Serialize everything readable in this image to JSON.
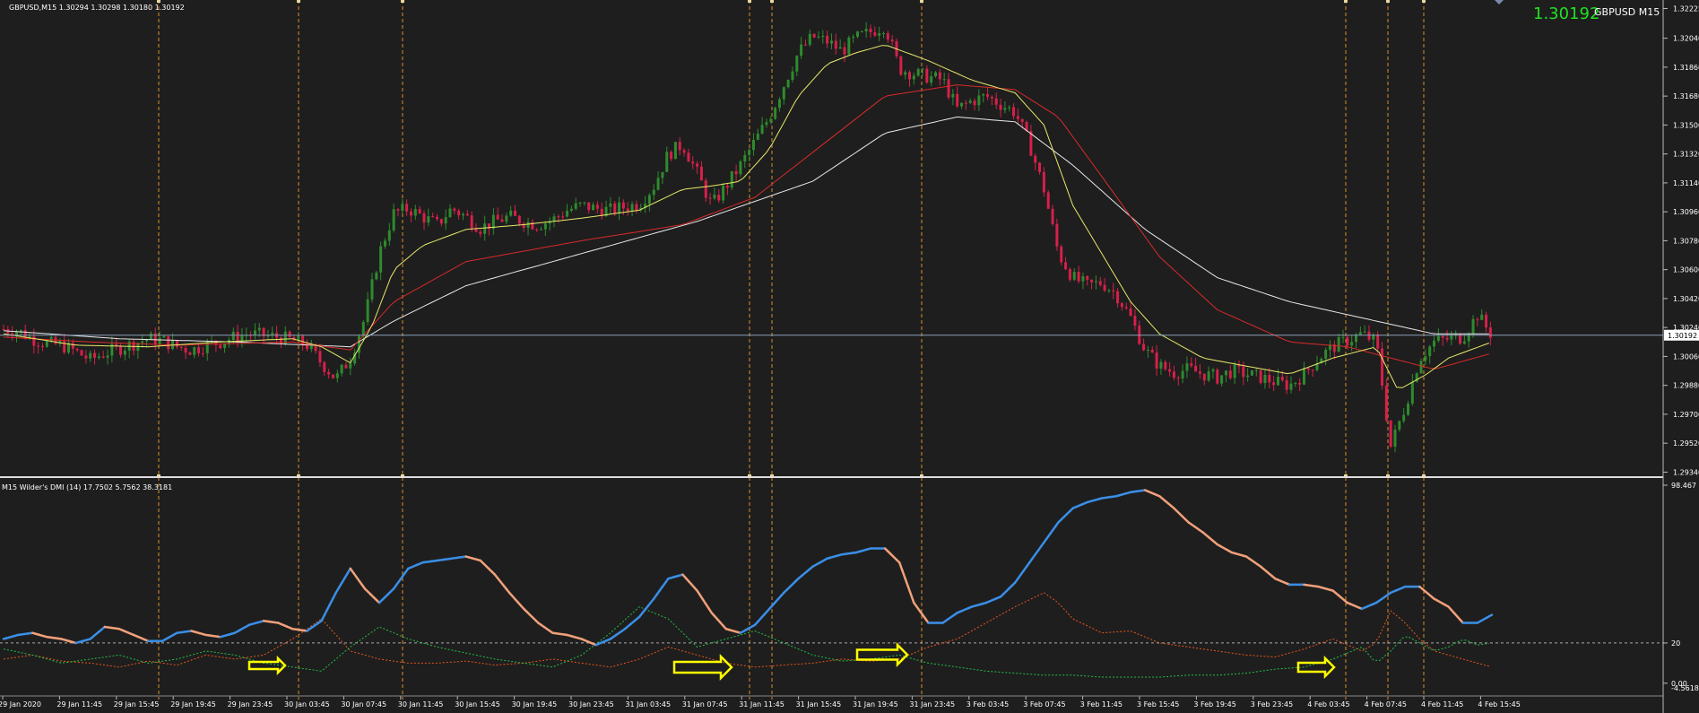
{
  "header": {
    "symbol_info": "GBPUSD,M15  1.30294 1.30298 1.30180 1.30192",
    "current_price": "1.30192",
    "symbol_tf": "GBPUSD M15"
  },
  "indicator": {
    "title": "M15 Wilder's DMI (14) 17.7502 5.7562 38.3181"
  },
  "colors": {
    "background": "#1e1e1e",
    "bull_candle": "#2e8b2e",
    "bear_candle": "#d6204a",
    "ma_fast": "#e8e86a",
    "ma_mid": "#d82a2a",
    "ma_slow": "#e8e8e8",
    "adx_up": "#3a8ee6",
    "adx_down": "#f0a07a",
    "plus_di": "#22c04a",
    "minus_di": "#e8561c",
    "session_line": "#d8902a",
    "current_price_line": "#8aa0b8",
    "big_price": "#22e022",
    "arrow": "#ffff00"
  },
  "price_axis": {
    "ticks": [
      "1.32225",
      "1.32040",
      "1.31860",
      "1.31680",
      "1.31500",
      "1.31320",
      "1.31140",
      "1.30960",
      "1.30780",
      "1.30600",
      "1.30420",
      "1.30240",
      "1.30060",
      "1.29880",
      "1.29700",
      "1.29520",
      "1.29340"
    ],
    "current_label": "1.30192"
  },
  "indicator_axis": {
    "ticks": [
      "98.467",
      "20",
      "0.00"
    ],
    "bottom_label": "-4.5618"
  },
  "time_axis": {
    "labels": [
      "29 Jan 2020",
      "29 Jan 11:45",
      "29 Jan 15:45",
      "29 Jan 19:45",
      "29 Jan 23:45",
      "30 Jan 03:45",
      "30 Jan 07:45",
      "30 Jan 11:45",
      "30 Jan 15:45",
      "30 Jan 19:45",
      "30 Jan 23:45",
      "31 Jan 03:45",
      "31 Jan 07:45",
      "31 Jan 11:45",
      "31 Jan 15:45",
      "31 Jan 19:45",
      "31 Jan 23:45",
      "3 Feb 03:45",
      "3 Feb 07:45",
      "3 Feb 11:45",
      "3 Feb 15:45",
      "3 Feb 19:45",
      "3 Feb 23:45",
      "4 Feb 03:45",
      "4 Feb 07:45",
      "4 Feb 11:45",
      "4 Feb 15:45"
    ]
  },
  "chart_data": {
    "type": "candlestick",
    "symbol": "GBPUSD",
    "timeframe": "M15",
    "price_range": [
      1.2932,
      1.3225
    ],
    "close_path": [
      [
        0,
        1.3023
      ],
      [
        10,
        1.3022
      ],
      [
        20,
        1.3017
      ],
      [
        30,
        1.3014
      ],
      [
        40,
        1.3013
      ],
      [
        50,
        1.3009
      ],
      [
        60,
        1.3004
      ],
      [
        70,
        1.3008
      ],
      [
        80,
        1.3011
      ],
      [
        90,
        1.3014
      ],
      [
        100,
        1.3017
      ],
      [
        110,
        1.3016
      ],
      [
        120,
        1.3012
      ],
      [
        130,
        1.301
      ],
      [
        140,
        1.3013
      ],
      [
        150,
        1.3015
      ],
      [
        160,
        1.3018
      ],
      [
        170,
        1.302
      ],
      [
        180,
        1.3019
      ],
      [
        190,
        1.3018
      ],
      [
        200,
        1.3016
      ],
      [
        210,
        1.3013
      ],
      [
        220,
        1.3002
      ],
      [
        230,
        1.2992
      ],
      [
        240,
        1.3005
      ],
      [
        250,
        1.303
      ],
      [
        260,
        1.307
      ],
      [
        270,
        1.3095
      ],
      [
        280,
        1.3098
      ],
      [
        290,
        1.3093
      ],
      [
        300,
        1.3088
      ],
      [
        310,
        1.3098
      ],
      [
        320,
        1.3093
      ],
      [
        330,
        1.3086
      ],
      [
        340,
        1.309
      ],
      [
        350,
        1.3093
      ],
      [
        360,
        1.309
      ],
      [
        370,
        1.3088
      ],
      [
        380,
        1.3091
      ],
      [
        390,
        1.3097
      ],
      [
        400,
        1.31
      ],
      [
        410,
        1.3098
      ],
      [
        420,
        1.3097
      ],
      [
        430,
        1.3099
      ],
      [
        440,
        1.3101
      ],
      [
        450,
        1.3112
      ],
      [
        460,
        1.3132
      ],
      [
        470,
        1.3138
      ],
      [
        480,
        1.312
      ],
      [
        490,
        1.31
      ],
      [
        500,
        1.3112
      ],
      [
        510,
        1.3125
      ],
      [
        520,
        1.314
      ],
      [
        530,
        1.3155
      ],
      [
        540,
        1.3175
      ],
      [
        550,
        1.3195
      ],
      [
        560,
        1.3205
      ],
      [
        570,
        1.3202
      ],
      [
        580,
        1.3196
      ],
      [
        590,
        1.3204
      ],
      [
        600,
        1.3208
      ],
      [
        610,
        1.3212
      ],
      [
        620,
        1.3185
      ],
      [
        630,
        1.3182
      ],
      [
        640,
        1.318
      ],
      [
        650,
        1.3178
      ],
      [
        660,
        1.316
      ],
      [
        670,
        1.3165
      ],
      [
        680,
        1.3168
      ],
      [
        690,
        1.3163
      ],
      [
        700,
        1.3158
      ],
      [
        710,
        1.3138
      ],
      [
        720,
        1.311
      ],
      [
        730,
        1.307
      ],
      [
        740,
        1.3055
      ],
      [
        750,
        1.305
      ],
      [
        760,
        1.3052
      ],
      [
        770,
        1.3045
      ],
      [
        780,
        1.303
      ],
      [
        790,
        1.301
      ],
      [
        800,
        1.3
      ],
      [
        810,
        1.2996
      ],
      [
        820,
        1.2998
      ],
      [
        830,
        1.2995
      ],
      [
        840,
        1.2993
      ],
      [
        850,
        1.2997
      ],
      [
        860,
        1.2995
      ],
      [
        870,
        1.2993
      ],
      [
        880,
        1.299
      ],
      [
        890,
        1.2988
      ],
      [
        900,
        1.2995
      ],
      [
        910,
        1.3005
      ],
      [
        920,
        1.3012
      ],
      [
        930,
        1.3016
      ],
      [
        940,
        1.302
      ],
      [
        950,
        1.3015
      ],
      [
        960,
        1.295
      ],
      [
        970,
        1.2975
      ],
      [
        980,
        1.3005
      ],
      [
        990,
        1.3015
      ],
      [
        1000,
        1.3017
      ],
      [
        1010,
        1.3018
      ],
      [
        1020,
        1.3032
      ],
      [
        1030,
        1.3019
      ]
    ],
    "ma_fast_path": [
      [
        0,
        1.302
      ],
      [
        50,
        1.3013
      ],
      [
        100,
        1.3012
      ],
      [
        150,
        1.3015
      ],
      [
        200,
        1.3017
      ],
      [
        220,
        1.3012
      ],
      [
        240,
        1.3002
      ],
      [
        255,
        1.3025
      ],
      [
        270,
        1.306
      ],
      [
        290,
        1.3075
      ],
      [
        320,
        1.3085
      ],
      [
        360,
        1.3088
      ],
      [
        400,
        1.3092
      ],
      [
        440,
        1.3097
      ],
      [
        470,
        1.311
      ],
      [
        490,
        1.3112
      ],
      [
        510,
        1.3115
      ],
      [
        530,
        1.3135
      ],
      [
        550,
        1.3168
      ],
      [
        570,
        1.3188
      ],
      [
        590,
        1.3195
      ],
      [
        610,
        1.32
      ],
      [
        640,
        1.319
      ],
      [
        670,
        1.3178
      ],
      [
        700,
        1.317
      ],
      [
        720,
        1.315
      ],
      [
        740,
        1.31
      ],
      [
        760,
        1.307
      ],
      [
        780,
        1.304
      ],
      [
        800,
        1.302
      ],
      [
        830,
        1.3005
      ],
      [
        860,
        1.3
      ],
      [
        890,
        1.2995
      ],
      [
        920,
        1.3005
      ],
      [
        950,
        1.3012
      ],
      [
        965,
        1.2985
      ],
      [
        985,
        1.2995
      ],
      [
        1000,
        1.3005
      ],
      [
        1030,
        1.3015
      ]
    ],
    "ma_mid_path": [
      [
        0,
        1.3018
      ],
      [
        60,
        1.3015
      ],
      [
        120,
        1.3013
      ],
      [
        200,
        1.3015
      ],
      [
        240,
        1.301
      ],
      [
        270,
        1.304
      ],
      [
        320,
        1.3065
      ],
      [
        400,
        1.3078
      ],
      [
        470,
        1.3088
      ],
      [
        520,
        1.3105
      ],
      [
        570,
        1.314
      ],
      [
        610,
        1.3168
      ],
      [
        660,
        1.3175
      ],
      [
        700,
        1.3172
      ],
      [
        730,
        1.3155
      ],
      [
        760,
        1.3118
      ],
      [
        800,
        1.3068
      ],
      [
        840,
        1.3035
      ],
      [
        890,
        1.3015
      ],
      [
        930,
        1.3012
      ],
      [
        960,
        1.3005
      ],
      [
        990,
        1.2998
      ],
      [
        1030,
        1.3008
      ]
    ],
    "ma_slow_path": [
      [
        0,
        1.3022
      ],
      [
        80,
        1.3017
      ],
      [
        160,
        1.3015
      ],
      [
        240,
        1.3012
      ],
      [
        270,
        1.3028
      ],
      [
        320,
        1.305
      ],
      [
        400,
        1.307
      ],
      [
        480,
        1.309
      ],
      [
        560,
        1.3115
      ],
      [
        610,
        1.3145
      ],
      [
        660,
        1.3155
      ],
      [
        700,
        1.3152
      ],
      [
        740,
        1.3125
      ],
      [
        790,
        1.3085
      ],
      [
        840,
        1.3055
      ],
      [
        890,
        1.304
      ],
      [
        940,
        1.303
      ],
      [
        990,
        1.302
      ],
      [
        1030,
        1.302
      ]
    ],
    "adx_path": [
      [
        0,
        22
      ],
      [
        10,
        24
      ],
      [
        20,
        25
      ],
      [
        30,
        23
      ],
      [
        40,
        22
      ],
      [
        50,
        20
      ],
      [
        60,
        22
      ],
      [
        70,
        28
      ],
      [
        80,
        27
      ],
      [
        90,
        24
      ],
      [
        100,
        21
      ],
      [
        110,
        21
      ],
      [
        120,
        25
      ],
      [
        130,
        26
      ],
      [
        140,
        24
      ],
      [
        150,
        23
      ],
      [
        160,
        25
      ],
      [
        170,
        29
      ],
      [
        180,
        31
      ],
      [
        190,
        30
      ],
      [
        200,
        27
      ],
      [
        210,
        26
      ],
      [
        220,
        31
      ],
      [
        230,
        45
      ],
      [
        240,
        57
      ],
      [
        250,
        47
      ],
      [
        260,
        40
      ],
      [
        270,
        47
      ],
      [
        280,
        57
      ],
      [
        290,
        60
      ],
      [
        300,
        61
      ],
      [
        310,
        62
      ],
      [
        320,
        63
      ],
      [
        330,
        61
      ],
      [
        340,
        54
      ],
      [
        350,
        45
      ],
      [
        360,
        37
      ],
      [
        370,
        30
      ],
      [
        380,
        25
      ],
      [
        390,
        24
      ],
      [
        400,
        22
      ],
      [
        410,
        19
      ],
      [
        420,
        22
      ],
      [
        430,
        27
      ],
      [
        440,
        33
      ],
      [
        450,
        42
      ],
      [
        460,
        52
      ],
      [
        470,
        54
      ],
      [
        480,
        46
      ],
      [
        490,
        35
      ],
      [
        500,
        27
      ],
      [
        510,
        25
      ],
      [
        520,
        29
      ],
      [
        530,
        37
      ],
      [
        540,
        45
      ],
      [
        550,
        52
      ],
      [
        560,
        58
      ],
      [
        570,
        62
      ],
      [
        580,
        64
      ],
      [
        590,
        65
      ],
      [
        600,
        67
      ],
      [
        610,
        67
      ],
      [
        620,
        60
      ],
      [
        630,
        40
      ],
      [
        640,
        30
      ],
      [
        650,
        30
      ],
      [
        660,
        35
      ],
      [
        670,
        38
      ],
      [
        680,
        40
      ],
      [
        690,
        43
      ],
      [
        700,
        50
      ],
      [
        710,
        60
      ],
      [
        720,
        70
      ],
      [
        730,
        80
      ],
      [
        740,
        87
      ],
      [
        750,
        90
      ],
      [
        760,
        92
      ],
      [
        770,
        93
      ],
      [
        780,
        95
      ],
      [
        790,
        96
      ],
      [
        800,
        93
      ],
      [
        810,
        87
      ],
      [
        820,
        80
      ],
      [
        830,
        75
      ],
      [
        840,
        69
      ],
      [
        850,
        65
      ],
      [
        860,
        63
      ],
      [
        870,
        58
      ],
      [
        880,
        52
      ],
      [
        890,
        49
      ],
      [
        900,
        49
      ],
      [
        910,
        48
      ],
      [
        920,
        46
      ],
      [
        930,
        40
      ],
      [
        940,
        37
      ],
      [
        950,
        40
      ],
      [
        960,
        45
      ],
      [
        970,
        48
      ],
      [
        980,
        48
      ],
      [
        990,
        42
      ],
      [
        1000,
        38
      ],
      [
        1010,
        30
      ],
      [
        1020,
        30
      ],
      [
        1030,
        34
      ]
    ],
    "plus_di_path": [
      [
        0,
        17
      ],
      [
        20,
        14
      ],
      [
        40,
        10
      ],
      [
        60,
        12
      ],
      [
        80,
        14
      ],
      [
        100,
        10
      ],
      [
        120,
        12
      ],
      [
        140,
        16
      ],
      [
        160,
        14
      ],
      [
        180,
        10
      ],
      [
        200,
        8
      ],
      [
        220,
        6
      ],
      [
        240,
        18
      ],
      [
        260,
        28
      ],
      [
        280,
        22
      ],
      [
        300,
        18
      ],
      [
        320,
        15
      ],
      [
        340,
        12
      ],
      [
        360,
        10
      ],
      [
        380,
        8
      ],
      [
        400,
        14
      ],
      [
        420,
        25
      ],
      [
        440,
        38
      ],
      [
        460,
        32
      ],
      [
        480,
        18
      ],
      [
        500,
        22
      ],
      [
        520,
        26
      ],
      [
        540,
        20
      ],
      [
        560,
        14
      ],
      [
        580,
        11
      ],
      [
        600,
        12
      ],
      [
        620,
        14
      ],
      [
        640,
        10
      ],
      [
        660,
        8
      ],
      [
        680,
        6
      ],
      [
        700,
        5
      ],
      [
        720,
        4
      ],
      [
        740,
        4
      ],
      [
        760,
        3
      ],
      [
        780,
        3
      ],
      [
        800,
        3
      ],
      [
        820,
        4
      ],
      [
        840,
        4
      ],
      [
        860,
        5
      ],
      [
        880,
        7
      ],
      [
        900,
        8
      ],
      [
        920,
        12
      ],
      [
        940,
        18
      ],
      [
        950,
        10
      ],
      [
        960,
        16
      ],
      [
        970,
        24
      ],
      [
        980,
        20
      ],
      [
        990,
        16
      ],
      [
        1000,
        18
      ],
      [
        1010,
        22
      ],
      [
        1020,
        19
      ],
      [
        1030,
        20
      ]
    ],
    "minus_di_path": [
      [
        0,
        12
      ],
      [
        20,
        14
      ],
      [
        40,
        11
      ],
      [
        60,
        10
      ],
      [
        80,
        8
      ],
      [
        100,
        11
      ],
      [
        120,
        9
      ],
      [
        140,
        14
      ],
      [
        160,
        12
      ],
      [
        180,
        14
      ],
      [
        200,
        22
      ],
      [
        220,
        32
      ],
      [
        240,
        16
      ],
      [
        260,
        12
      ],
      [
        280,
        10
      ],
      [
        300,
        10
      ],
      [
        320,
        11
      ],
      [
        340,
        9
      ],
      [
        360,
        10
      ],
      [
        380,
        12
      ],
      [
        400,
        10
      ],
      [
        420,
        8
      ],
      [
        440,
        12
      ],
      [
        460,
        18
      ],
      [
        480,
        14
      ],
      [
        500,
        10
      ],
      [
        520,
        8
      ],
      [
        540,
        9
      ],
      [
        560,
        10
      ],
      [
        580,
        12
      ],
      [
        600,
        11
      ],
      [
        620,
        12
      ],
      [
        640,
        18
      ],
      [
        660,
        22
      ],
      [
        680,
        30
      ],
      [
        700,
        38
      ],
      [
        720,
        45
      ],
      [
        730,
        40
      ],
      [
        740,
        32
      ],
      [
        760,
        25
      ],
      [
        780,
        26
      ],
      [
        800,
        20
      ],
      [
        820,
        18
      ],
      [
        840,
        16
      ],
      [
        860,
        14
      ],
      [
        880,
        13
      ],
      [
        900,
        17
      ],
      [
        920,
        22
      ],
      [
        940,
        16
      ],
      [
        950,
        20
      ],
      [
        960,
        36
      ],
      [
        970,
        30
      ],
      [
        980,
        22
      ],
      [
        990,
        16
      ],
      [
        1000,
        14
      ],
      [
        1010,
        12
      ],
      [
        1020,
        10
      ],
      [
        1030,
        8
      ]
    ],
    "indicator_range": [
      -4.5618,
      98.467
    ],
    "level": 20,
    "current_price": 1.30192
  }
}
